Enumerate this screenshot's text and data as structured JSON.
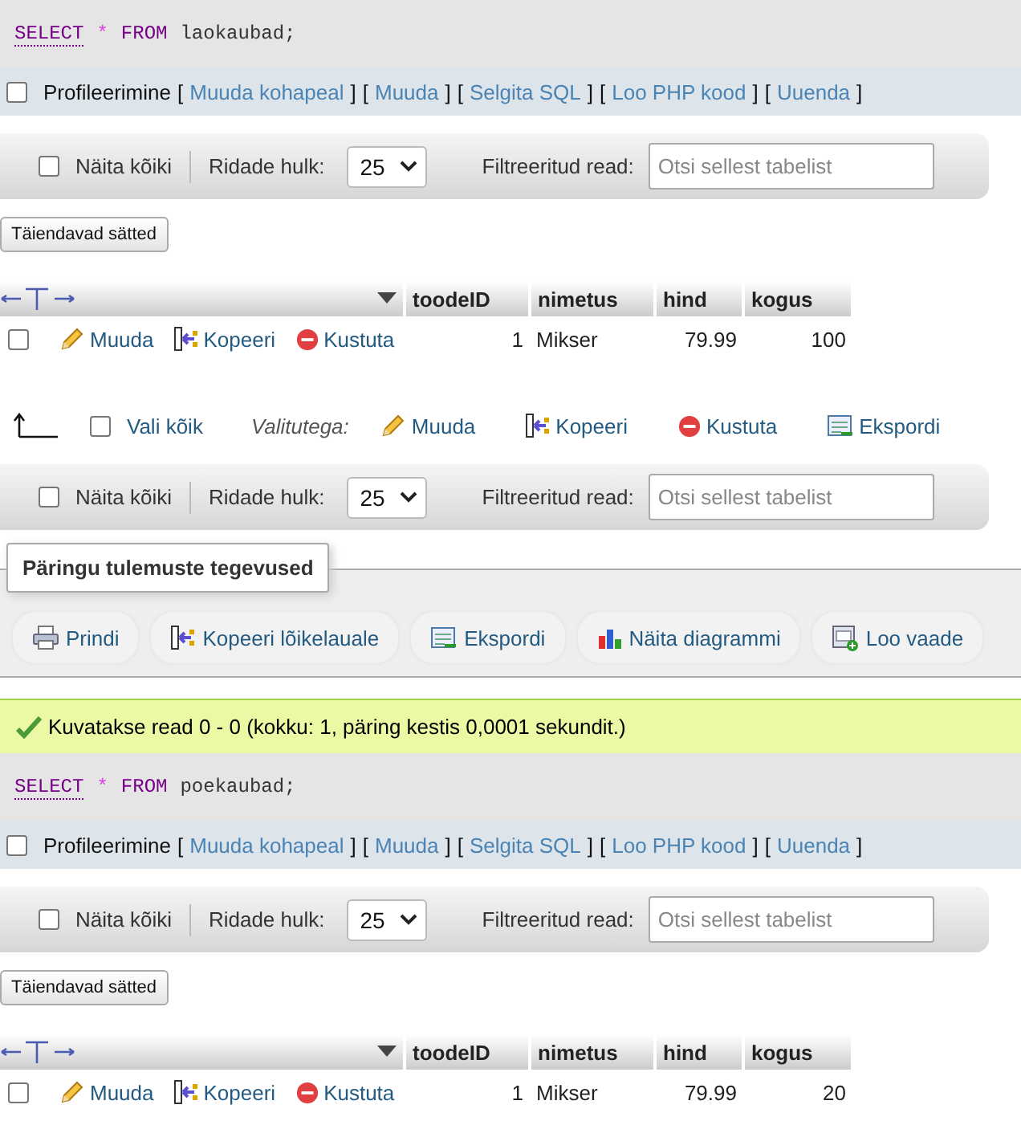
{
  "results": [
    {
      "query": [
        {
          "text": "SELECT",
          "kind": "keyword",
          "linked": true
        },
        {
          "text": "*",
          "kind": "operator",
          "linked": false
        },
        {
          "text": "FROM",
          "kind": "keyword",
          "linked": false
        },
        {
          "text": "laokaubad;",
          "kind": "identifier",
          "linked": false
        }
      ],
      "profiling": {
        "label": "Profileerimine",
        "checked": false,
        "bracket_open": "[",
        "bracket_close": "]",
        "links": [
          "Muuda kohapeal",
          "Muuda",
          "Selgita SQL",
          "Loo PHP kood",
          "Uuenda"
        ]
      },
      "navigation": {
        "show_all": {
          "label": "Näita kõiki",
          "checked": false
        },
        "rows_label": "Ridade hulk:",
        "rows_value": "25",
        "filter_label": "Filtreeritud read:",
        "filter_placeholder": "Otsi sellest tabelist"
      },
      "options_button": "Täiendavad sätted",
      "table": {
        "columns": [
          {
            "label": "toodeID",
            "kind": "numeric"
          },
          {
            "label": "nimetus",
            "kind": "text"
          },
          {
            "label": "hind",
            "kind": "numeric"
          },
          {
            "label": "kogus",
            "kind": "numeric"
          }
        ],
        "rows": [
          {
            "selected": false,
            "actions": [
              {
                "kind": "edit",
                "label": "Muuda"
              },
              {
                "kind": "copy",
                "label": "Kopeeri"
              },
              {
                "kind": "delete",
                "label": "Kustuta"
              }
            ],
            "cells": [
              "1",
              "Mikser",
              "79.99",
              "100"
            ]
          }
        ]
      },
      "bulk": {
        "select_all": {
          "label": "Vali kõik",
          "checked": false
        },
        "with_selected": "Valitutega:",
        "actions": [
          {
            "kind": "edit",
            "label": "Muuda"
          },
          {
            "kind": "copy",
            "label": "Kopeeri"
          },
          {
            "kind": "delete",
            "label": "Kustuta"
          },
          {
            "kind": "export",
            "label": "Ekspordi"
          }
        ]
      },
      "navigation_bottom": {
        "show_all": {
          "label": "Näita kõiki",
          "checked": false
        },
        "rows_label": "Ridade hulk:",
        "rows_value": "25",
        "filter_label": "Filtreeritud read:",
        "filter_placeholder": "Otsi sellest tabelist"
      },
      "operations": {
        "legend": "Päringu tulemuste tegevused",
        "actions": [
          {
            "kind": "print",
            "label": "Prindi"
          },
          {
            "kind": "copy",
            "label": "Kopeeri lõikelauale"
          },
          {
            "kind": "export",
            "label": "Ekspordi"
          },
          {
            "kind": "chart",
            "label": "Näita diagrammi"
          },
          {
            "kind": "view",
            "label": "Loo vaade"
          }
        ]
      },
      "message": {
        "kind": "success",
        "text": "Kuvatakse read 0 - 0 (kokku: 1, päring kestis 0,0001 sekundit.)"
      }
    },
    {
      "query": [
        {
          "text": "SELECT",
          "kind": "keyword",
          "linked": true
        },
        {
          "text": "*",
          "kind": "operator",
          "linked": false
        },
        {
          "text": "FROM",
          "kind": "keyword",
          "linked": false
        },
        {
          "text": "poekaubad;",
          "kind": "identifier",
          "linked": false
        }
      ],
      "profiling": {
        "label": "Profileerimine",
        "checked": false,
        "bracket_open": "[",
        "bracket_close": "]",
        "links": [
          "Muuda kohapeal",
          "Muuda",
          "Selgita SQL",
          "Loo PHP kood",
          "Uuenda"
        ]
      },
      "navigation": {
        "show_all": {
          "label": "Näita kõiki",
          "checked": false
        },
        "rows_label": "Ridade hulk:",
        "rows_value": "25",
        "filter_label": "Filtreeritud read:",
        "filter_placeholder": "Otsi sellest tabelist"
      },
      "options_button": "Täiendavad sätted",
      "table": {
        "columns": [
          {
            "label": "toodeID",
            "kind": "numeric"
          },
          {
            "label": "nimetus",
            "kind": "text"
          },
          {
            "label": "hind",
            "kind": "numeric"
          },
          {
            "label": "kogus",
            "kind": "numeric"
          }
        ],
        "rows": [
          {
            "selected": false,
            "actions": [
              {
                "kind": "edit",
                "label": "Muuda"
              },
              {
                "kind": "copy",
                "label": "Kopeeri"
              },
              {
                "kind": "delete",
                "label": "Kustuta"
              }
            ],
            "cells": [
              "1",
              "Mikser",
              "79.99",
              "20"
            ]
          }
        ]
      }
    }
  ]
}
